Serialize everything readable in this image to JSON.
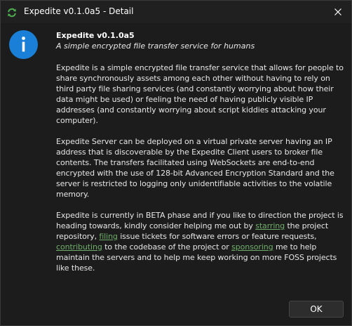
{
  "window": {
    "title": "Expedite v0.1.0a5 - Detail",
    "app_icon": "refresh-arrows-icon",
    "close_icon": "close-icon"
  },
  "dialog": {
    "icon": "info-icon",
    "heading": "Expedite v0.1.0a5",
    "subtitle": "A simple encrypted file transfer service for humans",
    "para1": "Expedite is a simple encrypted file transfer service that allows for people to share synchronously assets among each other without having to rely on third party file sharing services (and constantly worrying about how their data might be used) or feeling the need of having publicly visible IP addresses (and constantly worrying about script kiddies attacking your computer).",
    "para2": "Expedite Server can be deployed on a virtual private server having an IP address that is discoverable by the Expedite Client users to broker file contents. The transfers facilitated using WebSockets are end-to-end encrypted with the use of 128-bit Advanced Encryption Standard and the server is restricted to logging only unidentifiable activities to the volatile memory.",
    "para3": {
      "t1": "Expedite is currently in BETA phase and if you like to direction the project is heading towards, kindly consider helping me out by ",
      "link_starring": "starring",
      "t2": " the project repository, ",
      "link_filing": "filing",
      "t3": " issue tickets for software errors or feature requests, ",
      "link_contributing": "contributing",
      "t4": " to the codebase of the project or ",
      "link_sponsoring": "sponsoring",
      "t5": " me to help maintain the servers and to help me keep working on more FOSS projects like these."
    }
  },
  "footer": {
    "ok_label": "OK"
  },
  "colors": {
    "background": "#1c1c1c",
    "accent_blue": "#1a7fd6",
    "link_green": "#6fae6a",
    "app_icon_green": "#4caf50"
  }
}
